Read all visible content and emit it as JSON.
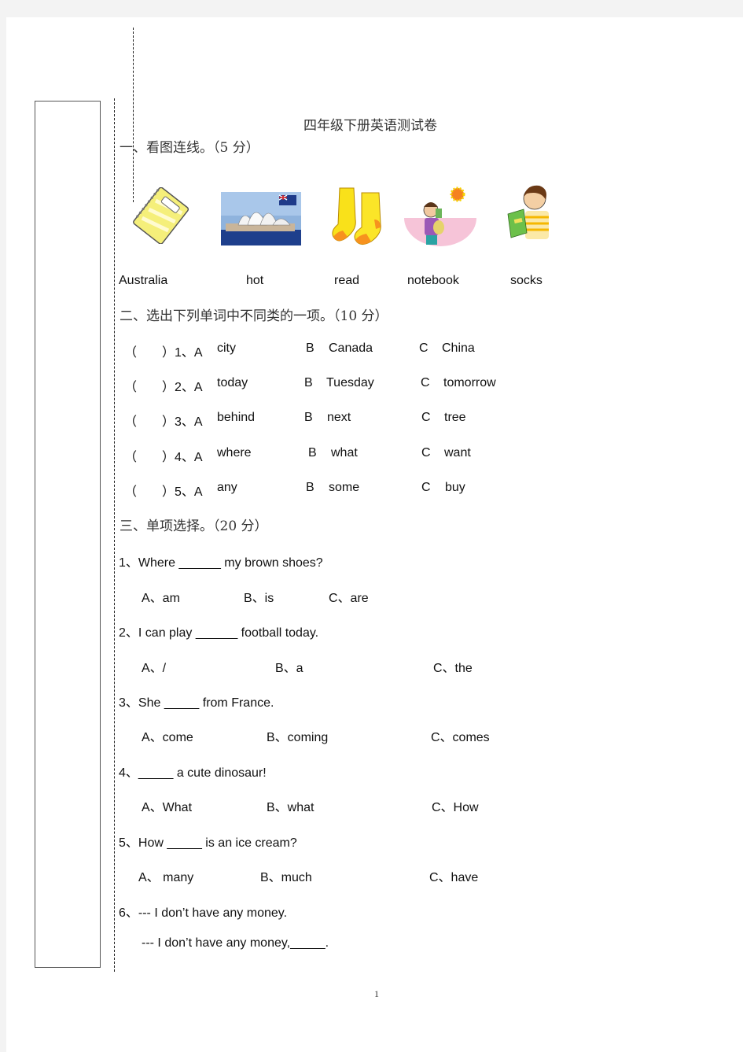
{
  "title": "四年级下册英语测试卷",
  "sections": [
    {
      "heading": "一、看图连线。（5 分）",
      "pictures": [
        {
          "name": "notebook-picture",
          "depicts": "notebook"
        },
        {
          "name": "sydney-opera-house-picture",
          "depicts": "Sydney Opera House with Australian flag"
        },
        {
          "name": "socks-picture",
          "depicts": "yellow socks"
        },
        {
          "name": "hot-boy-picture",
          "depicts": "boy sweating under the sun"
        },
        {
          "name": "reading-boy-picture",
          "depicts": "boy reading a book"
        }
      ],
      "words": [
        "Australia",
        "hot",
        "read",
        "notebook",
        "socks"
      ]
    },
    {
      "heading": "二、选出下列单词中不同类的一项。（10 分）",
      "items": [
        {
          "num": "（　　）1、A",
          "a": "city",
          "b_label": "B",
          "b": "Canada",
          "c_label": "C",
          "c": "China"
        },
        {
          "num": "（　　）2、A",
          "a": "today",
          "b_label": "B",
          "b": "Tuesday",
          "c_label": "C",
          "c": "tomorrow"
        },
        {
          "num": "（　　）3、A",
          "a": "behind",
          "b_label": "B",
          "b": "next",
          "c_label": "C",
          "c": "tree"
        },
        {
          "num": "（　　）4、A",
          "a": "where",
          "b_label": "B",
          "b": "what",
          "c_label": "C",
          "c": "want"
        },
        {
          "num": "（　　）5、A",
          "a": "any",
          "b_label": "B",
          "b": "some",
          "c_label": "C",
          "c": "buy"
        }
      ]
    },
    {
      "heading": "三、单项选择。（20 分）",
      "questions": [
        {
          "q": "1、Where ______ my brown shoes?",
          "a": "A、am",
          "b": "B、is",
          "c": "C、are"
        },
        {
          "q": "2、I can play ______ football today.",
          "a": "A、/",
          "b": "B、a",
          "c": "C、the"
        },
        {
          "q": "3、She _____ from France.",
          "a": "A、come",
          "b": "B、coming",
          "c": "C、comes"
        },
        {
          "q": "4、_____ a cute dinosaur!",
          "a": "A、What",
          "b": "B、what",
          "c": "C、How"
        },
        {
          "q": "5、How _____ is an ice cream?",
          "a": "A、 many",
          "b": "B、much",
          "c": "C、have"
        },
        {
          "q": "6、--- I don’t have any money.",
          "q2": "--- I don’t have any money,_____."
        }
      ]
    }
  ],
  "page_number": "1"
}
